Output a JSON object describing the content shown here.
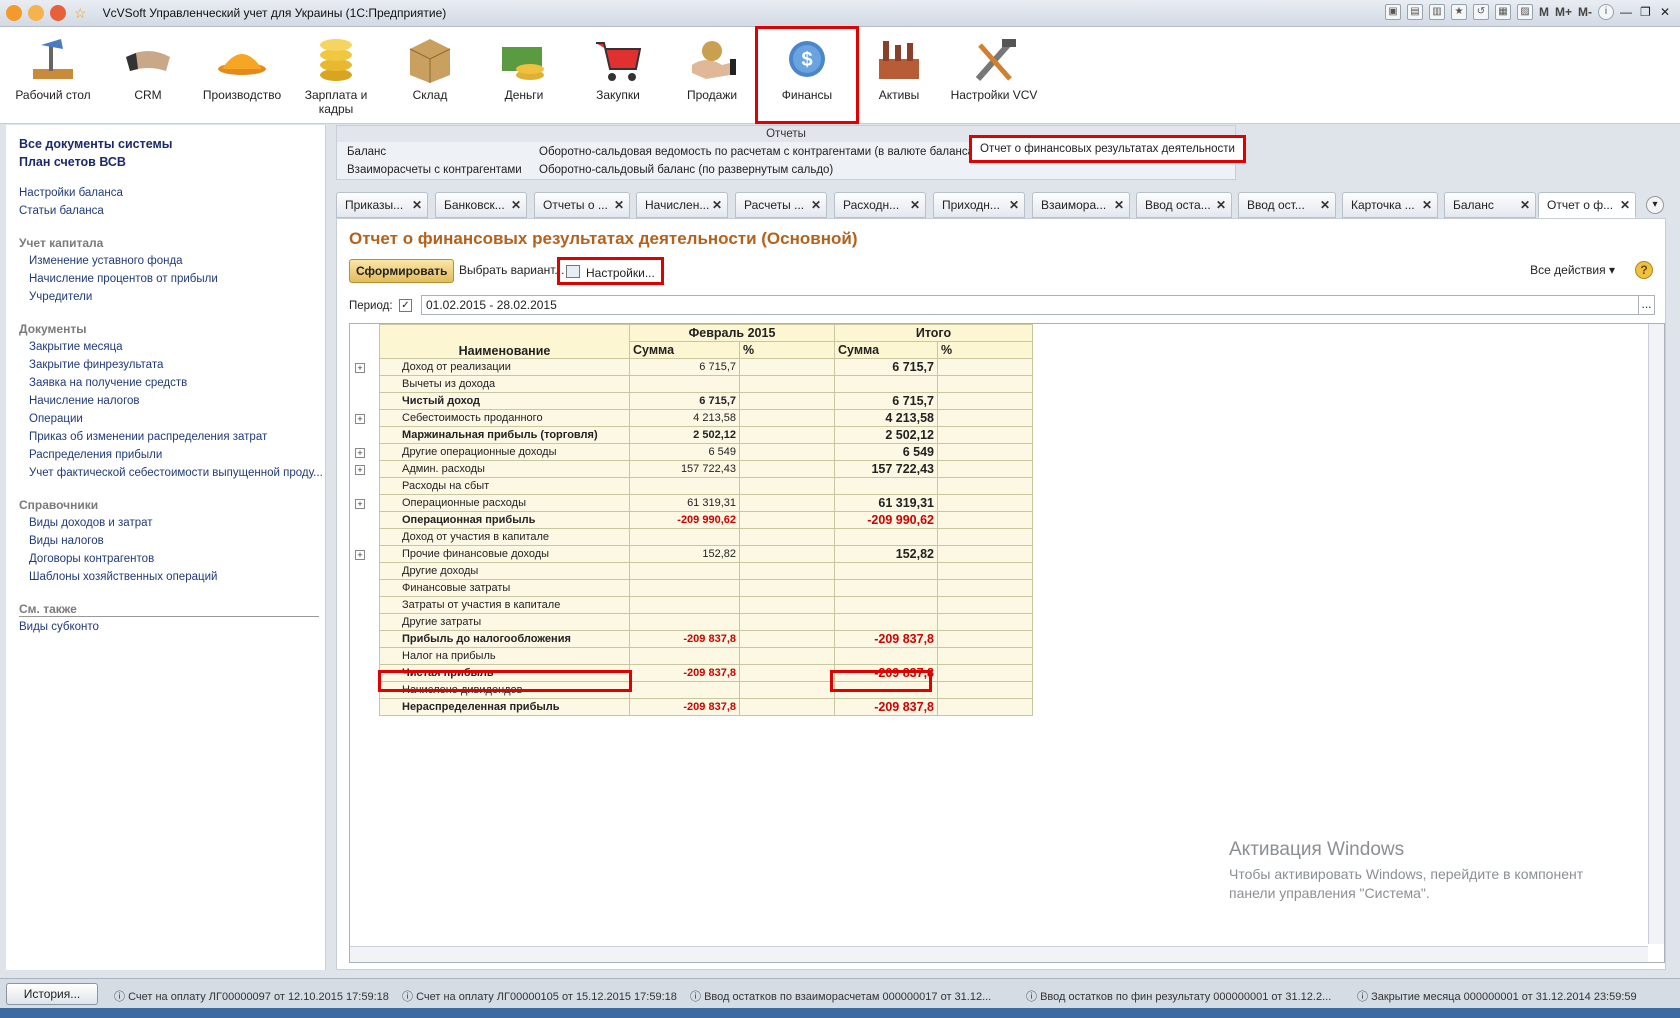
{
  "window": {
    "title": "VcVSoft Управленческий учет для Украины  (1С:Предприятие)",
    "quick": [
      "M",
      "M+",
      "M-"
    ]
  },
  "sections": [
    {
      "label": "Рабочий стол",
      "icon": "desk-lamp-icon"
    },
    {
      "label": "CRM",
      "icon": "handshake-icon"
    },
    {
      "label": "Производство",
      "icon": "hardhat-icon"
    },
    {
      "label": "Зарплата и кадры",
      "icon": "coins-icon"
    },
    {
      "label": "Склад",
      "icon": "box-icon"
    },
    {
      "label": "Деньги",
      "icon": "money-icon"
    },
    {
      "label": "Закупки",
      "icon": "cart-icon"
    },
    {
      "label": "Продажи",
      "icon": "hand-coin-icon"
    },
    {
      "label": "Финансы",
      "icon": "dollar-coin-icon",
      "active": true
    },
    {
      "label": "Активы",
      "icon": "factory-icon"
    },
    {
      "label": "Настройки VCV",
      "icon": "tools-icon"
    }
  ],
  "left": {
    "top_links": [
      "Все документы системы",
      "План счетов ВСВ"
    ],
    "links1": [
      "Настройки баланса",
      "Статьи баланса"
    ],
    "capital": {
      "title": "Учет капитала",
      "items": [
        "Изменение уставного фонда",
        "Начисление процентов от прибыли",
        "Учредители"
      ]
    },
    "documents": {
      "title": "Документы",
      "items": [
        "Закрытие месяца",
        "Закрытие финрезультата",
        "Заявка на получение средств",
        "Начисление налогов",
        "Операции",
        "Приказ об изменении распределения затрат",
        "Распределения прибыли",
        "Учет фактической себестоимости выпущенной проду..."
      ]
    },
    "directories": {
      "title": "Справочники",
      "items": [
        "Виды доходов и затрат",
        "Виды налогов",
        "Договоры контрагентов",
        "Шаблоны хозяйственных операций"
      ]
    },
    "see_also": {
      "title": "См. также",
      "items": [
        "Виды субконто"
      ]
    }
  },
  "reports": {
    "title": "Отчеты",
    "links": [
      "Баланс",
      "Взаиморасчеты с контрагентами",
      "Оборотно-сальдовая ведомость по расчетам с контрагентами (в валюте баланса)",
      "Оборотно-сальдовый баланс (по развернутым сальдо)",
      "Отчет о финансовых результатах деятельности"
    ]
  },
  "tabs": [
    "Приказы...",
    "Банковск...",
    "Отчеты о ...",
    "Начислен...",
    "Расчеты ...",
    "Расходн...",
    "Приходн...",
    "Взаимора...",
    "Ввод оста...",
    "Ввод ост...",
    "Карточка ...",
    "Баланс",
    "Отчет о ф..."
  ],
  "report": {
    "title": "Отчет о финансовых результатах деятельности (Основной)",
    "generate": "Сформировать",
    "variant": "Выбрать вариант...",
    "settings": "Настройки...",
    "all_actions": "Все действия",
    "help": "?",
    "period_label": "Период:",
    "period_value": "01.02.2015 - 28.02.2015",
    "dots": "...",
    "headers": {
      "name": "Наименование",
      "month": "Февраль 2015",
      "total": "Итого",
      "sum": "Сумма",
      "pct": "%"
    },
    "rows": [
      {
        "name": "Доход от реализации",
        "sum": "6 715,7",
        "total": "6 715,7",
        "plus": true,
        "bold": false,
        "neg": false
      },
      {
        "name": "Вычеты из дохода",
        "sum": "",
        "total": "",
        "plus": false,
        "bold": false,
        "neg": false
      },
      {
        "name": "Чистый доход",
        "sum": "6 715,7",
        "total": "6 715,7",
        "plus": false,
        "bold": true,
        "neg": false
      },
      {
        "name": "Себестоимость проданного",
        "sum": "4 213,58",
        "total": "4 213,58",
        "plus": true,
        "bold": false,
        "neg": false
      },
      {
        "name": "Маржинальная прибыль (торговля)",
        "sum": "2 502,12",
        "total": "2 502,12",
        "plus": false,
        "bold": true,
        "neg": false
      },
      {
        "name": "Другие операционные доходы",
        "sum": "6 549",
        "total": "6 549",
        "plus": true,
        "bold": false,
        "neg": false
      },
      {
        "name": "Админ. расходы",
        "sum": "157 722,43",
        "total": "157 722,43",
        "plus": true,
        "bold": false,
        "neg": false
      },
      {
        "name": "Расходы на сбыт",
        "sum": "",
        "total": "",
        "plus": false,
        "bold": false,
        "neg": false
      },
      {
        "name": "Операционные расходы",
        "sum": "61 319,31",
        "total": "61 319,31",
        "plus": true,
        "bold": false,
        "neg": false
      },
      {
        "name": "Операционная прибыль",
        "sum": "-209 990,62",
        "total": "-209 990,62",
        "plus": false,
        "bold": true,
        "neg": true
      },
      {
        "name": "Доход от участия в капитале",
        "sum": "",
        "total": "",
        "plus": false,
        "bold": false,
        "neg": false
      },
      {
        "name": "Прочие финансовые доходы",
        "sum": "152,82",
        "total": "152,82",
        "plus": true,
        "bold": false,
        "neg": false
      },
      {
        "name": "Другие доходы",
        "sum": "",
        "total": "",
        "plus": false,
        "bold": false,
        "neg": false
      },
      {
        "name": "Финансовые затраты",
        "sum": "",
        "total": "",
        "plus": false,
        "bold": false,
        "neg": false
      },
      {
        "name": "Затраты от участия в капитале",
        "sum": "",
        "total": "",
        "plus": false,
        "bold": false,
        "neg": false
      },
      {
        "name": "Другие затраты",
        "sum": "",
        "total": "",
        "plus": false,
        "bold": false,
        "neg": false
      },
      {
        "name": "Прибыль до налогообложения",
        "sum": "-209 837,8",
        "total": "-209 837,8",
        "plus": false,
        "bold": true,
        "neg": true
      },
      {
        "name": "Налог на прибыль",
        "sum": "",
        "total": "",
        "plus": false,
        "bold": false,
        "neg": false
      },
      {
        "name": "Чистая прибыль",
        "sum": "-209 837,8",
        "total": "-209 837,8",
        "plus": false,
        "bold": true,
        "neg": true
      },
      {
        "name": "Начислено дивидендов",
        "sum": "",
        "total": "",
        "plus": false,
        "bold": false,
        "neg": false
      },
      {
        "name": "Нераспределенная прибыль",
        "sum": "-209 837,8",
        "total": "-209 837,8",
        "plus": false,
        "bold": true,
        "neg": true
      }
    ]
  },
  "activation": {
    "title": "Активация Windows",
    "text1": "Чтобы активировать Windows, перейдите в компонент",
    "text2": "панели управления \"Система\"."
  },
  "status": {
    "history": "История...",
    "items": [
      "Счет на оплату ЛГ00000097 от 12.10.2015 17:59:18",
      "Счет на оплату ЛГ00000105 от 15.12.2015 17:59:18",
      "Ввод остатков по взаиморасчетам 000000017 от 31.12...",
      "Ввод остатков по фин результату 000000001 от 31.12.2...",
      "Закрытие месяца 000000001 от 31.12.2014 23:59:59"
    ]
  },
  "colors": {
    "accent_title": "#b4611c",
    "negative": "#d00000",
    "highlight": "#e00000"
  }
}
